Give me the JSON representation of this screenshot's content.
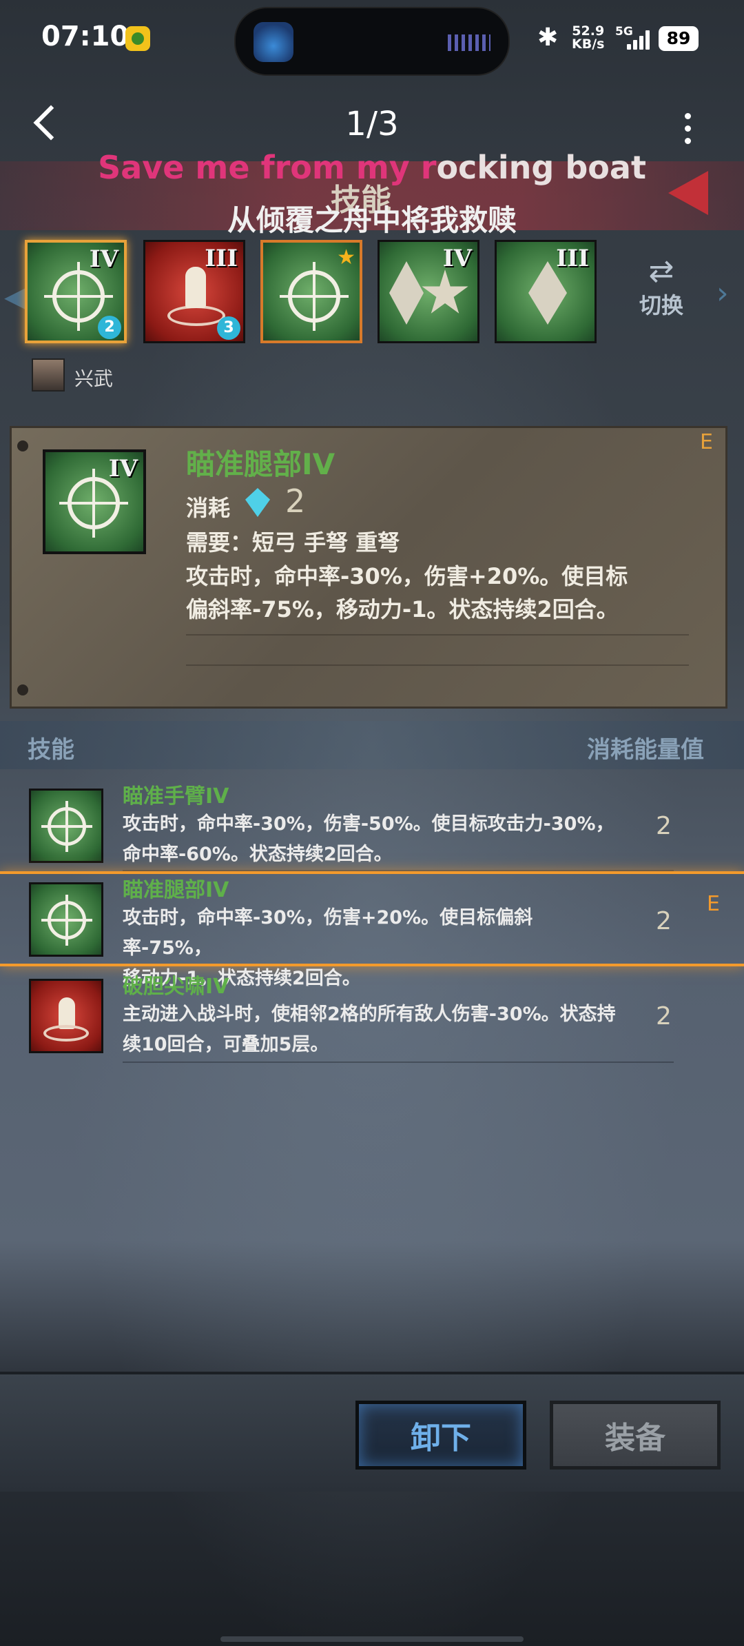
{
  "status_bar": {
    "time": "07:10",
    "net_speed_value": "52.9",
    "net_speed_unit": "KB/s",
    "network": "5G",
    "battery": "89",
    "icons": [
      "app-badge-icon",
      "bluetooth-icon",
      "signal-icon",
      "battery-icon"
    ]
  },
  "header": {
    "page_indicator": "1/3",
    "section_title": "技能",
    "lyric_line1_pink": "Save me from my r",
    "lyric_line1_rest": "ocking boat",
    "lyric_line2": "从倾覆之舟中将我救赎"
  },
  "skill_slots": [
    {
      "rank": "IV",
      "badge": "2",
      "color": "green",
      "icon": "target-icon",
      "selected": true
    },
    {
      "rank": "III",
      "badge": "3",
      "color": "red",
      "icon": "person-ring-icon",
      "selected": false
    },
    {
      "rank": "",
      "badge": "",
      "color": "green",
      "icon": "target-star-icon",
      "selected": false
    },
    {
      "rank": "IV",
      "badge": "",
      "color": "green",
      "icon": "diamond-burst-icon",
      "selected": false
    },
    {
      "rank": "III",
      "badge": "",
      "color": "green",
      "icon": "diamond-icon",
      "selected": false
    }
  ],
  "switch_label": "切换",
  "character": {
    "name": "兴武"
  },
  "detail": {
    "name": "瞄准腿部IV",
    "tag": "E",
    "cost_label": "消耗",
    "cost_value": "2",
    "requirement": "需要：短弓  手弩  重弩",
    "description_line1": "攻击时，命中率-30%，伤害+20%。使目标",
    "description_line2": "偏斜率-75%，移动力-1。状态持续2回合。"
  },
  "list_header": {
    "left": "技能",
    "right": "消耗能量值"
  },
  "skills": [
    {
      "name": "瞄准手臂IV",
      "desc_line1": "攻击时，命中率-30%，伤害-50%。使目标攻击力-30%，",
      "desc_line2": "命中率-60%。状态持续2回合。",
      "cost": "2",
      "tag": "",
      "color": "green"
    },
    {
      "name": "瞄准腿部IV",
      "desc_line1": "攻击时，命中率-30%，伤害+20%。使目标偏斜率-75%，",
      "desc_line2": "移动力-1。状态持续2回合。",
      "cost": "2",
      "tag": "E",
      "color": "green"
    },
    {
      "name": "破胆尖啸IV",
      "desc_line1": "主动进入战斗时，使相邻2格的所有敌人伤害-30%。状态持",
      "desc_line2": "续10回合，可叠加5层。",
      "cost": "2",
      "tag": "",
      "color": "red"
    }
  ],
  "buttons": {
    "unequip": "卸下",
    "equip": "装备"
  }
}
